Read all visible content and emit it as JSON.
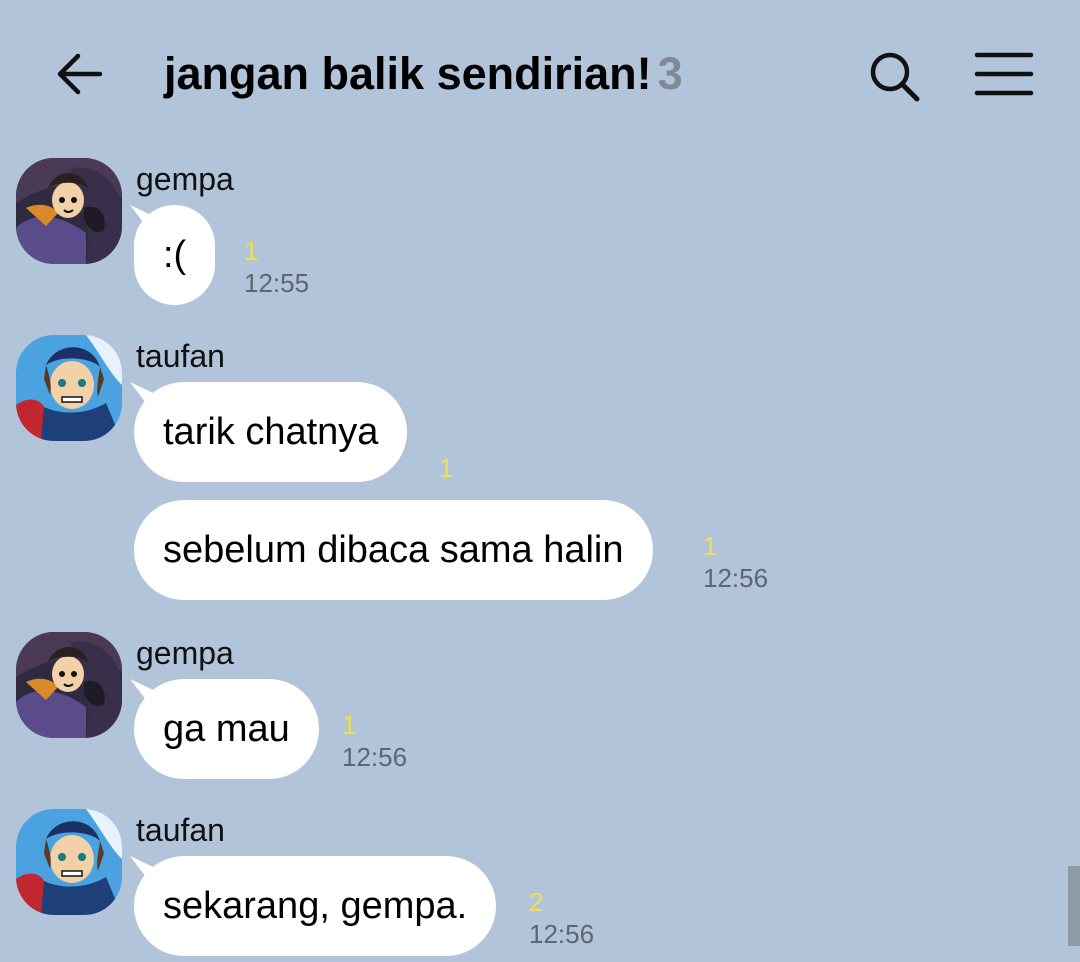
{
  "header": {
    "title": "jangan balik sendirian!",
    "member_count": "3",
    "back_icon": "arrow-left-icon",
    "search_icon": "search-icon",
    "menu_icon": "hamburger-menu-icon"
  },
  "colors": {
    "background": "#b1c4d9",
    "bubble": "#ffffff",
    "unread": "#ede24a",
    "timestamp": "#5d6670"
  },
  "messages": [
    {
      "sender": "gempa",
      "text": ":(",
      "unread": "1",
      "time": "12:55"
    },
    {
      "sender": "taufan",
      "text": "tarik chatnya",
      "unread": "1",
      "time": ""
    },
    {
      "sender": "",
      "text": "sebelum dibaca sama halin",
      "unread": "1",
      "time": "12:56"
    },
    {
      "sender": "gempa",
      "text": "ga mau",
      "unread": "1",
      "time": "12:56"
    },
    {
      "sender": "taufan",
      "text": "sekarang, gempa.",
      "unread": "2",
      "time": "12:56"
    }
  ]
}
